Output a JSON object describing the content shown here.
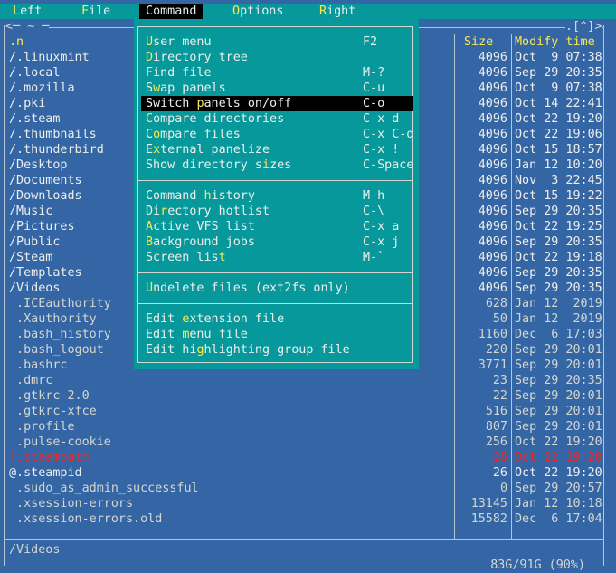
{
  "menubar": {
    "items": [
      {
        "pre": " ",
        "hot": "L",
        "post": "eft"
      },
      {
        "pre": "",
        "hot": "F",
        "post": "ile"
      },
      {
        "pre": "",
        "hot": "C",
        "post": "ommand"
      },
      {
        "pre": "",
        "hot": "O",
        "post": "ptions"
      },
      {
        "pre": "",
        "hot": "R",
        "post": "ight"
      }
    ]
  },
  "panel": {
    "top_left_marker": "<─ ~ ─",
    "top_right_marker": ".[^]>",
    "col_size": "Size",
    "col_modify": "Modify time",
    "up_dir": ".n",
    "rows": [
      {
        "name": "/.linuxmint",
        "size": "4096",
        "date": "Oct  9 07:38"
      },
      {
        "name": "/.local",
        "size": "4096",
        "date": "Sep 29 20:35"
      },
      {
        "name": "/.mozilla",
        "size": "4096",
        "date": "Oct  9 07:38"
      },
      {
        "name": "/.pki",
        "size": "4096",
        "date": "Oct 14 22:41"
      },
      {
        "name": "/.steam",
        "size": "4096",
        "date": "Oct 22 19:20"
      },
      {
        "name": "/.thumbnails",
        "size": "4096",
        "date": "Oct 22 19:06"
      },
      {
        "name": "/.thunderbird",
        "size": "4096",
        "date": "Oct 15 18:57"
      },
      {
        "name": "/Desktop",
        "size": "4096",
        "date": "Jan 12 10:20"
      },
      {
        "name": "/Documents",
        "size": "4096",
        "date": "Nov  3 22:45"
      },
      {
        "name": "/Downloads",
        "size": "4096",
        "date": "Oct 15 19:22"
      },
      {
        "name": "/Music",
        "size": "4096",
        "date": "Sep 29 20:35"
      },
      {
        "name": "/Pictures",
        "size": "4096",
        "date": "Oct 22 19:25"
      },
      {
        "name": "/Public",
        "size": "4096",
        "date": "Sep 29 20:35"
      },
      {
        "name": "/Steam",
        "size": "4096",
        "date": "Oct 22 19:18"
      },
      {
        "name": "/Templates",
        "size": "4096",
        "date": "Sep 29 20:35"
      },
      {
        "name": "/Videos",
        "size": "4096",
        "date": "Sep 29 20:35"
      },
      {
        "name": " .ICEauthority",
        "size": "628",
        "date": "Jan 12  2019"
      },
      {
        "name": " .Xauthority",
        "size": "50",
        "date": "Jan 12  2019"
      },
      {
        "name": " .bash_history",
        "size": "1160",
        "date": "Dec  6 17:03"
      },
      {
        "name": " .bash_logout",
        "size": "220",
        "date": "Sep 29 20:01"
      },
      {
        "name": " .bashrc",
        "size": "3771",
        "date": "Sep 29 20:01"
      },
      {
        "name": " .dmrc",
        "size": "23",
        "date": "Sep 29 20:35"
      },
      {
        "name": " .gtkrc-2.0",
        "size": "22",
        "date": "Sep 29 20:01"
      },
      {
        "name": " .gtkrc-xfce",
        "size": "516",
        "date": "Sep 29 20:01"
      },
      {
        "name": " .profile",
        "size": "807",
        "date": "Sep 29 20:01"
      },
      {
        "name": " .pulse-cookie",
        "size": "256",
        "date": "Oct 22 19:20"
      },
      {
        "name": "!.steampath",
        "size": "28",
        "date": "Oct 22 19:20"
      },
      {
        "name": "@.steampid",
        "size": "26",
        "date": "Oct 22 19:20"
      },
      {
        "name": " .sudo_as_admin_successful",
        "size": "0",
        "date": "Sep 29 20:57"
      },
      {
        "name": " .xsession-errors",
        "size": "13145",
        "date": "Jan 12 10:18"
      },
      {
        "name": " .xsession-errors.old",
        "size": "15582",
        "date": "Dec  6 17:04"
      }
    ],
    "current_path": "/Videos",
    "disk_info": "83G/91G (90%)"
  },
  "dropdown": {
    "items": [
      {
        "pre": "",
        "hot": "U",
        "post": "ser menu",
        "key": "F2"
      },
      {
        "pre": "",
        "hot": "D",
        "post": "irectory tree",
        "key": ""
      },
      {
        "pre": "",
        "hot": "F",
        "post": "ind file",
        "key": "M-?"
      },
      {
        "pre": "S",
        "hot": "w",
        "post": "ap panels",
        "key": "C-u"
      },
      {
        "pre": "Switch ",
        "hot": "p",
        "post": "anels on/off",
        "key": "C-o"
      },
      {
        "pre": "",
        "hot": "C",
        "post": "ompare directories",
        "key": "C-x d"
      },
      {
        "pre": "C",
        "hot": "o",
        "post": "mpare files",
        "key": "C-x C-d"
      },
      {
        "pre": "E",
        "hot": "x",
        "post": "ternal panelize",
        "key": "C-x !"
      },
      {
        "pre": "Show directory s",
        "hot": "i",
        "post": "zes",
        "key": "C-Space"
      },
      {
        "pre": "Command ",
        "hot": "h",
        "post": "istory",
        "key": "M-h"
      },
      {
        "pre": "Di",
        "hot": "r",
        "post": "ectory hotlist",
        "key": "C-\\"
      },
      {
        "pre": "",
        "hot": "A",
        "post": "ctive VFS list",
        "key": "C-x a"
      },
      {
        "pre": "",
        "hot": "B",
        "post": "ackground jobs",
        "key": "C-x j"
      },
      {
        "pre": "Screen lis",
        "hot": "t",
        "post": "",
        "key": "M-`"
      },
      {
        "pre": "",
        "hot": "U",
        "post": "ndelete files (ext2fs only)",
        "key": ""
      },
      {
        "pre": "Edit ",
        "hot": "e",
        "post": "xtension file",
        "key": ""
      },
      {
        "pre": "Edit ",
        "hot": "m",
        "post": "enu file",
        "key": ""
      },
      {
        "pre": "Edit hi",
        "hot": "g",
        "post": "hlighting group file",
        "key": ""
      }
    ]
  }
}
